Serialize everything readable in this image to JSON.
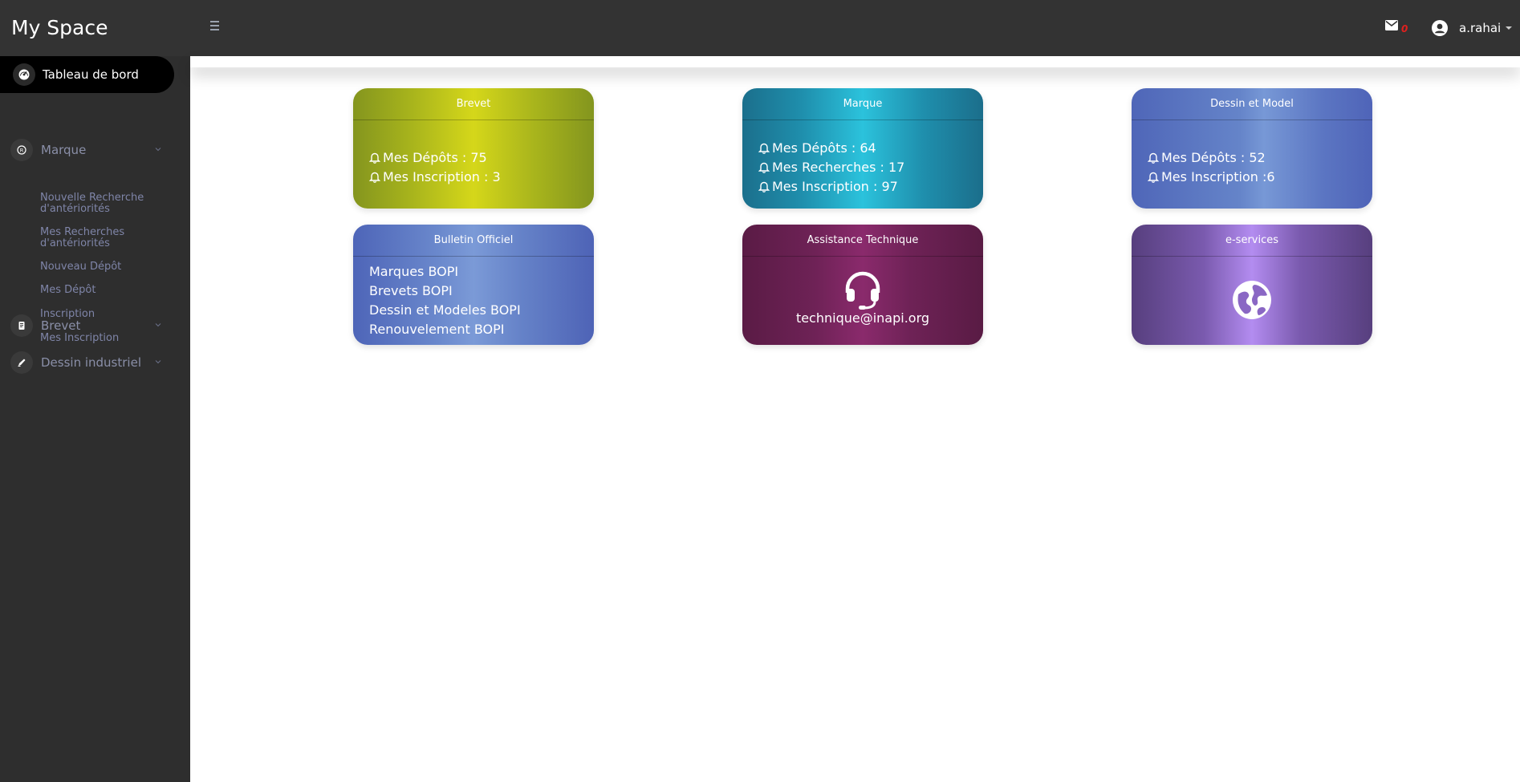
{
  "app": {
    "title": "My Space"
  },
  "topbar": {
    "mail_count": "0",
    "username": "a.rahai"
  },
  "sidebar": {
    "active": {
      "label": "Tableau de bord"
    },
    "groups": [
      {
        "label": "Marque",
        "icon": "registered-icon"
      },
      {
        "label": "Brevet",
        "icon": "scroll-icon"
      },
      {
        "label": "Dessin industriel",
        "icon": "pen-icon"
      }
    ],
    "marque_items": [
      "Nouvelle Recherche d'antériorités",
      "Mes Recherches d'antériorités",
      "Nouveau Dépôt",
      "Mes Dépôt",
      "Inscription",
      "Mes Inscription"
    ]
  },
  "cards": {
    "brevet": {
      "title": "Brevet",
      "lines": [
        "Mes Dépôts : 75",
        "Mes Inscription : 3"
      ]
    },
    "marque": {
      "title": "Marque",
      "lines": [
        "Mes Dépôts : 64",
        "Mes Recherches : 17",
        "Mes Inscription : 97"
      ]
    },
    "dessin": {
      "title": "Dessin et Model",
      "lines": [
        "Mes Dépôts : 52",
        "Mes Inscription :6"
      ]
    },
    "bulletin": {
      "title": "Bulletin Officiel",
      "links": [
        "Marques BOPI",
        "Brevets BOPI",
        "Dessin et Modeles BOPI",
        "Renouvelement BOPI"
      ]
    },
    "assistance": {
      "title": "Assistance Technique",
      "email": "technique@inapi.org"
    },
    "eservices": {
      "title": "e-services"
    }
  },
  "colors": {
    "topbar": "#333333",
    "sidebar": "#2e2e2e",
    "active_item": "#000000",
    "sidebar_text": "#8a8fa8",
    "mail_badge": "#e0201e"
  }
}
